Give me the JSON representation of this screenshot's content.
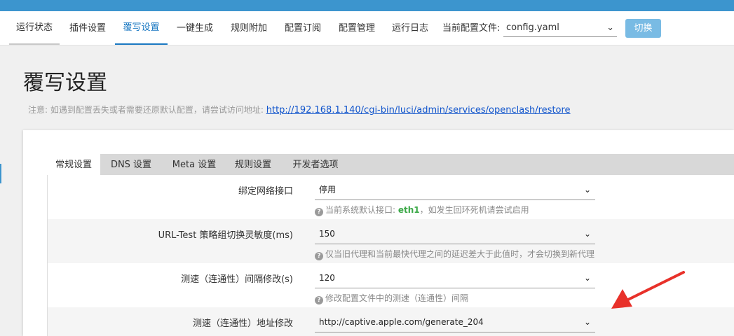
{
  "nav": {
    "tabs": [
      {
        "label": "运行状态"
      },
      {
        "label": "插件设置"
      },
      {
        "label": "覆写设置"
      },
      {
        "label": "一键生成"
      },
      {
        "label": "规则附加"
      },
      {
        "label": "配置订阅"
      },
      {
        "label": "配置管理"
      },
      {
        "label": "运行日志"
      }
    ],
    "config_label": "当前配置文件:",
    "config_value": "config.yaml",
    "switch_label": "切换"
  },
  "page": {
    "title": "覆写设置",
    "notice_prefix": "注意: 如遇到配置丢失或者需要还原默认配置，请尝试访问地址:",
    "notice_link": "http://192.168.1.140/cgi-bin/luci/admin/services/openclash/restore"
  },
  "subtabs": [
    {
      "label": "常规设置"
    },
    {
      "label": "DNS 设置"
    },
    {
      "label": "Meta 设置"
    },
    {
      "label": "规则设置"
    },
    {
      "label": "开发者选项"
    }
  ],
  "rows": [
    {
      "label": "绑定网络接口",
      "value": "停用",
      "hint_prefix": "当前系统默认接口:",
      "hint_highlight": "eth1",
      "hint_suffix": "，如发生回环死机请尝试启用"
    },
    {
      "label": "URL-Test 策略组切换灵敏度(ms)",
      "value": "150",
      "hint": "仅当旧代理和当前最快代理之间的延迟差大于此值时，才会切换到新代理"
    },
    {
      "label": "测速（连通性）间隔修改(s)",
      "value": "120",
      "hint": "修改配置文件中的测速（连通性）间隔"
    },
    {
      "label": "测速（连通性）地址修改",
      "value": "http://captive.apple.com/generate_204"
    }
  ],
  "icons": {
    "chevron": "chevron-down-icon",
    "help": "question-circle-icon",
    "arrow": "red-arrow-annotation"
  },
  "colors": {
    "topbar": "#3c95ce",
    "active_tab": "#1a78c2",
    "button": "#79bbe4",
    "highlight": "#3aa846",
    "arrow": "#e8312a"
  }
}
